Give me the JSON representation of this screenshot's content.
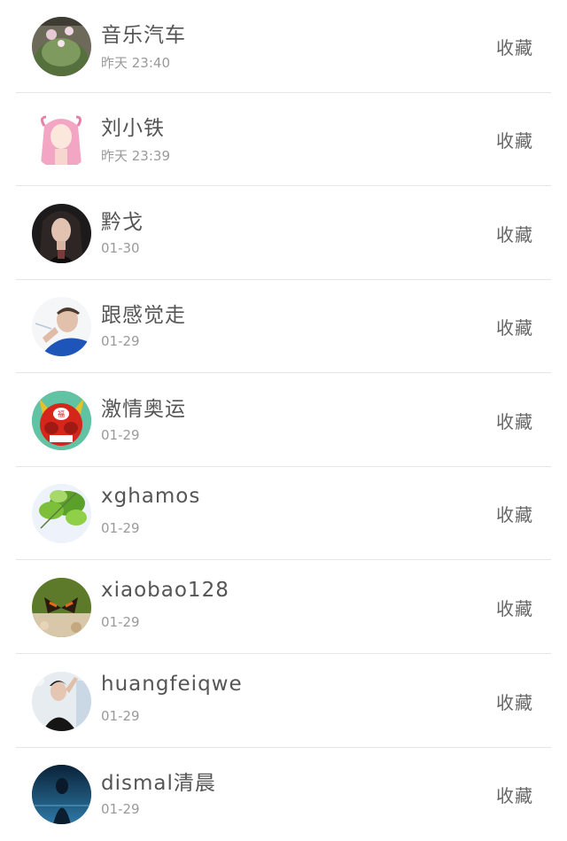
{
  "items": [
    {
      "name": "音乐汽车",
      "time": "昨天 23:40",
      "action": "收藏",
      "avatar": "cactus-avatar"
    },
    {
      "name": "刘小铁",
      "time": "昨天 23:39",
      "action": "收藏",
      "avatar": "pink-hair-girl-avatar"
    },
    {
      "name": "黔戈",
      "time": "01-30",
      "action": "收藏",
      "avatar": "woman-portrait-avatar"
    },
    {
      "name": "跟感觉走",
      "time": "01-29",
      "action": "收藏",
      "avatar": "man-smoking-avatar"
    },
    {
      "name": "激情奥运",
      "time": "01-29",
      "action": "收藏",
      "avatar": "red-devil-mascot-avatar"
    },
    {
      "name": "xghamos",
      "time": "01-29",
      "action": "收藏",
      "avatar": "green-leaves-avatar"
    },
    {
      "name": "xiaobao128",
      "time": "01-29",
      "action": "收藏",
      "avatar": "butterfly-avatar"
    },
    {
      "name": "huangfeiqwe",
      "time": "01-29",
      "action": "收藏",
      "avatar": "man-selfie-avatar"
    },
    {
      "name": "dismal清晨",
      "time": "01-29",
      "action": "收藏",
      "avatar": "dark-blue-figure-avatar"
    }
  ]
}
